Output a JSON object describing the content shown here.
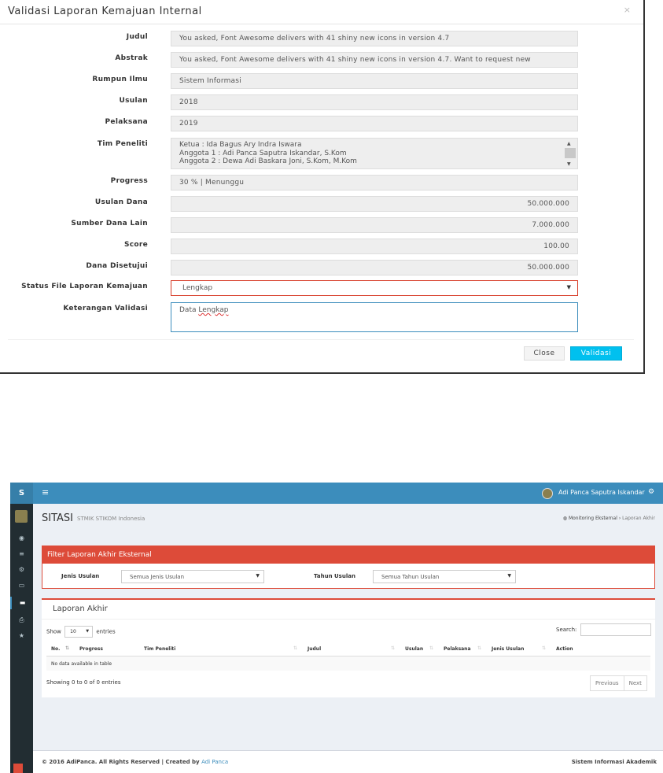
{
  "modal": {
    "title": "Validasi Laporan Kemajuan Internal",
    "close_x": "×",
    "fields": {
      "judul": {
        "label": "Judul",
        "value": "You asked, Font Awesome delivers with 41 shiny new icons in version 4.7"
      },
      "abstrak": {
        "label": "Abstrak",
        "value": "You asked, Font Awesome delivers with 41 shiny new icons in version 4.7. Want to request new"
      },
      "rumpun": {
        "label": "Rumpun Ilmu",
        "value": "Sistem Informasi"
      },
      "usulan": {
        "label": "Usulan",
        "value": "2018"
      },
      "pelaksana": {
        "label": "Pelaksana",
        "value": "2019"
      },
      "tim": {
        "label": "Tim Peneliti",
        "lines": [
          "Ketua : Ida Bagus Ary Indra Iswara",
          "Anggota 1 : Adi Panca Saputra Iskandar, S.Kom",
          "Anggota 2 : Dewa Adi Baskara Joni, S.Kom, M.Kom"
        ]
      },
      "progress": {
        "label": "Progress",
        "value": "30 %  |  Menunggu"
      },
      "usulan_dana": {
        "label": "Usulan Dana",
        "value": "50.000.000"
      },
      "sumber_dana": {
        "label": "Sumber Dana Lain",
        "value": "7.000.000"
      },
      "score": {
        "label": "Score",
        "value": "100.00"
      },
      "dana_disetujui": {
        "label": "Dana Disetujui",
        "value": "50.000.000"
      },
      "status_file": {
        "label": "Status File Laporan Kemajuan",
        "value": "Lengkap"
      },
      "keterangan": {
        "label": "Keterangan Validasi",
        "value_prefix": "Data ",
        "value_word": "Lengkap"
      }
    },
    "close_label": "Close",
    "validasi_label": "Validasi"
  },
  "app": {
    "logo_letter": "S",
    "user_name": "Adi Panca Saputra Iskandar",
    "page_title": "SITASI",
    "page_subtitle": "STMIK STIKOM Indonesia",
    "breadcrumb": [
      "Monitoring Eksternal",
      "Laporan Akhir"
    ],
    "filter": {
      "title": "Filter Laporan Akhir Eksternal",
      "jenis_label": "Jenis Usulan",
      "jenis_value": "Semua Jenis Usulan",
      "tahun_label": "Tahun Usulan",
      "tahun_value": "Semua Tahun Usulan"
    },
    "table": {
      "title": "Laporan Akhir",
      "show_label": "Show",
      "entries_value": "10",
      "entries_label": "entries",
      "search_label": "Search:",
      "columns": [
        "No.",
        "Progress",
        "Tim Peneliti",
        "Judul",
        "Usulan",
        "Pelaksana",
        "Jenis Usulan",
        "Action"
      ],
      "empty_text": "No data available in table",
      "info_text": "Showing 0 to 0 of 0 entries",
      "prev_label": "Previous",
      "next_label": "Next"
    },
    "footer": {
      "copyright": "© 2016 AdiPanca. All Rights Reserved | Created by ",
      "author_link": "Adi Panca",
      "right_text": "Sistem Informasi Akademik"
    }
  },
  "colors": {
    "primary": "#3c8dbc",
    "danger": "#dd4b39",
    "info": "#00c0ef",
    "sidebar": "#222d32"
  }
}
